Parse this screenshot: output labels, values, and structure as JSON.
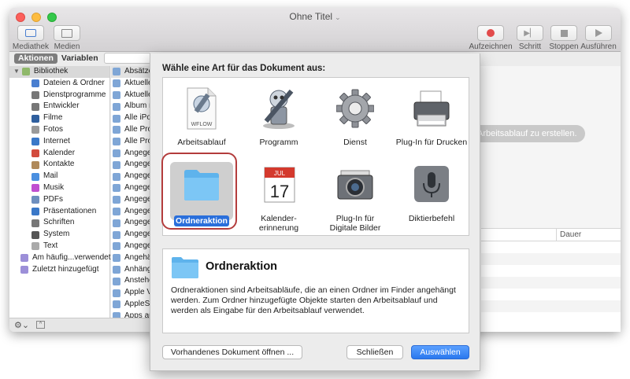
{
  "window": {
    "title": "Ohne Titel"
  },
  "toolbar": {
    "library_label": "Mediathek",
    "media_label": "Medien",
    "record_label": "Aufzeichnen",
    "step_label": "Schritt",
    "stop_label": "Stoppen",
    "run_label": "Ausführen"
  },
  "segmented": {
    "actions": "Aktionen",
    "variables": "Variablen"
  },
  "library": {
    "root": "Bibliothek",
    "items": [
      {
        "label": "Dateien & Ordner",
        "color": "#4a7fd0"
      },
      {
        "label": "Dienstprogramme",
        "color": "#777777"
      },
      {
        "label": "Entwickler",
        "color": "#777777"
      },
      {
        "label": "Filme",
        "color": "#2f5f9e"
      },
      {
        "label": "Fotos",
        "color": "#9a9a9a"
      },
      {
        "label": "Internet",
        "color": "#3a78c8"
      },
      {
        "label": "Kalender",
        "color": "#d24b3d"
      },
      {
        "label": "Kontakte",
        "color": "#b08a5a"
      },
      {
        "label": "Mail",
        "color": "#4a8fe0"
      },
      {
        "label": "Musik",
        "color": "#c04fd0"
      },
      {
        "label": "PDFs",
        "color": "#6e8fbf"
      },
      {
        "label": "Präsentationen",
        "color": "#3a78c8"
      },
      {
        "label": "Schriften",
        "color": "#777777"
      },
      {
        "label": "System",
        "color": "#555555"
      },
      {
        "label": "Text",
        "color": "#aaaaaa"
      }
    ],
    "smart_groups": [
      {
        "label": "Am häufig...verwendet",
        "color": "#9c8fd8"
      },
      {
        "label": "Zuletzt hinzugefügt",
        "color": "#9c8fd8"
      }
    ]
  },
  "actions_column": [
    "Absätze",
    "Aktuelle",
    "Aktuelle",
    "Album n",
    "Alle iPo",
    "Alle Pro",
    "Alle Pro",
    "Angege",
    "Angege",
    "Angege",
    "Angege",
    "Angege",
    "Angege",
    "Angege",
    "Angege",
    "Angege",
    "Angehä",
    "Anhäng",
    "Anstehe",
    "Apple V",
    "AppleSc",
    "Apps au"
  ],
  "workflow": {
    "hint": "Arbeitsablauf zu erstellen.",
    "log_column": "Dauer"
  },
  "sheet": {
    "title": "Wähle eine Art für das Dokument aus:",
    "types": [
      {
        "label": "Arbeitsablauf",
        "icon": "workflow-document-icon"
      },
      {
        "label": "Programm",
        "icon": "automator-robot-icon"
      },
      {
        "label": "Dienst",
        "icon": "gear-icon"
      },
      {
        "label": "Plug-In für\nDrucken",
        "icon": "printer-icon"
      },
      {
        "label": "Ordneraktion",
        "icon": "folder-icon",
        "selected": true
      },
      {
        "label": "Kalender-\nerinnerung",
        "icon": "calendar-icon"
      },
      {
        "label": "Plug-In für\nDigitale Bilder",
        "icon": "camera-icon"
      },
      {
        "label": "Diktierbefehl",
        "icon": "microphone-icon"
      }
    ],
    "wflow_badge": "WFLOW",
    "calendar_month": "JUL",
    "calendar_day": "17",
    "description": {
      "title": "Ordneraktion",
      "text": "Ordneraktionen sind Arbeitsabläufe, die an einen Ordner im Finder angehängt werden. Zum Ordner hinzugefügte Objekte starten den Arbeitsablauf und werden als Eingabe für den Arbeitsablauf verwendet."
    },
    "buttons": {
      "open_existing": "Vorhandenes Dokument öffnen ...",
      "close": "Schließen",
      "choose": "Auswählen"
    }
  },
  "colors": {
    "accent": "#2a6fdb",
    "highlight_ring": "#b33c3c"
  }
}
